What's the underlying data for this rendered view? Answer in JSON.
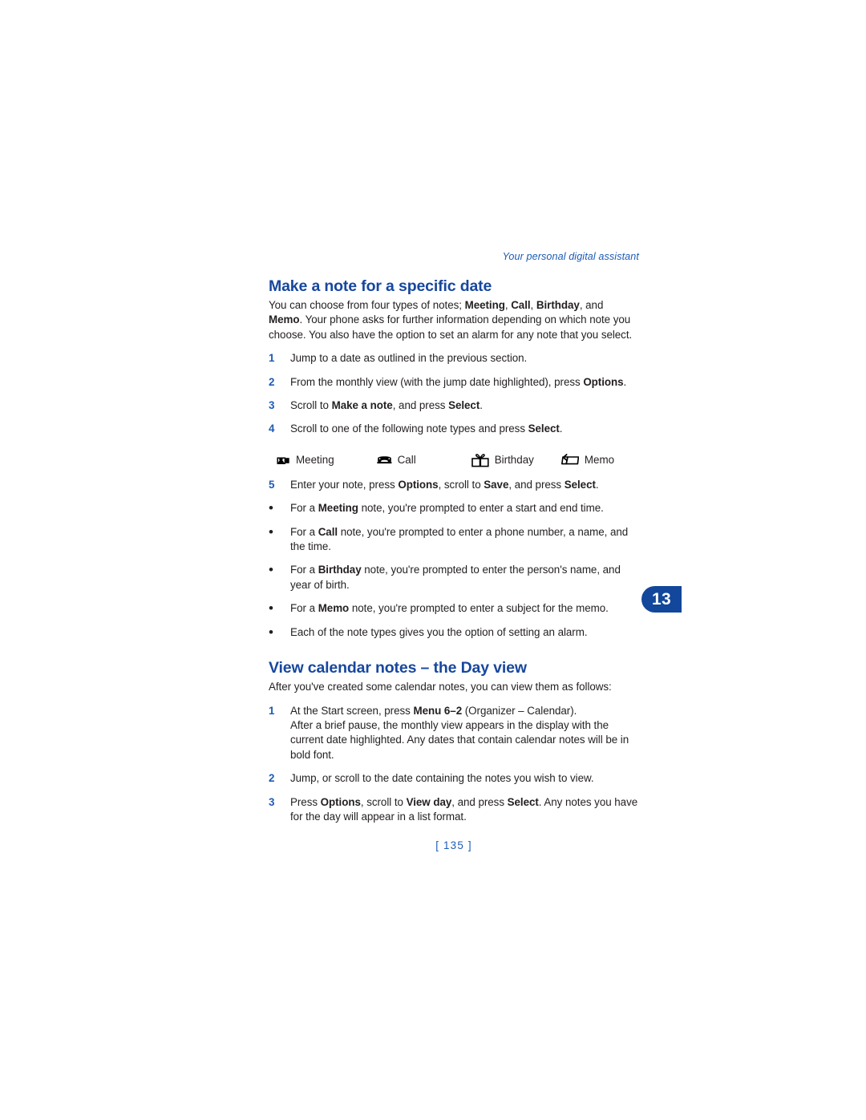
{
  "header": {
    "running_text": "Your personal digital assistant"
  },
  "colors": {
    "heading_blue": "#17479e",
    "accent_blue": "#1d5bb5",
    "tab_blue": "#12479b",
    "body_text": "#231f20"
  },
  "chapter_tab": {
    "number": "13"
  },
  "folio": {
    "text": "[ 135 ]"
  },
  "sections": [
    {
      "heading": "Make a note for a specific date",
      "intro_html": "You can choose from four types of notes; <b>Meeting</b>, <b>Call</b>, <b>Birthday</b>, and <b>Memo</b>. Your phone asks for further information depending on which note you choose. You also have the option to set an alarm for any note that you select.",
      "steps": [
        {
          "marker": "1",
          "text_html": "Jump to a date as outlined in the previous section."
        },
        {
          "marker": "2",
          "text_html": "From the monthly view (with the jump date highlighted), press <b>Options</b>."
        },
        {
          "marker": "3",
          "text_html": "Scroll to <b>Make a note</b>, and press <b>Select</b>."
        },
        {
          "marker": "4",
          "text_html": "Scroll to one of the following note types and press <b>Select</b>."
        }
      ],
      "legend": [
        {
          "icon": "meeting-icon",
          "label": "Meeting"
        },
        {
          "icon": "call-icon",
          "label": "Call"
        },
        {
          "icon": "birthday-gift-icon",
          "label": "Birthday"
        },
        {
          "icon": "memo-icon",
          "label": "Memo"
        }
      ],
      "steps_after_legend": [
        {
          "marker": "5",
          "type": "number",
          "text_html": "Enter your note, press <b>Options</b>, scroll to <b>Save</b>, and press <b>Select</b>."
        },
        {
          "marker": "•",
          "type": "bullet",
          "text_html": "For a <b>Meeting</b> note, you're prompted to enter a start and end time."
        },
        {
          "marker": "•",
          "type": "bullet",
          "text_html": "For a <b>Call</b> note, you're prompted to enter a phone number, a name, and the time."
        },
        {
          "marker": "•",
          "type": "bullet",
          "text_html": "For a <b>Birthday</b> note, you're prompted to enter the person's name, and year of birth."
        },
        {
          "marker": "•",
          "type": "bullet",
          "text_html": "For a <b>Memo</b> note, you're prompted to enter a subject for the memo."
        },
        {
          "marker": "•",
          "type": "bullet",
          "text_html": "Each of the note types gives you the option of setting an alarm."
        }
      ]
    },
    {
      "heading": "View calendar notes – the Day view",
      "intro_html": "After you've created some calendar notes, you can view them as follows:",
      "steps": [
        {
          "marker": "1",
          "text_html": "At the Start screen, press <b>Menu 6–2</b> (Organizer – Calendar).<br>After a brief pause, the monthly view appears in the display with the current date highlighted. Any dates that contain calendar notes will be in bold font."
        },
        {
          "marker": "2",
          "text_html": "Jump, or scroll to the date containing the notes you wish to view."
        },
        {
          "marker": "3",
          "text_html": "Press <b>Options</b>, scroll to <b>View day</b>, and press <b>Select</b>. Any notes you have for the day will appear in a list format."
        }
      ]
    }
  ]
}
